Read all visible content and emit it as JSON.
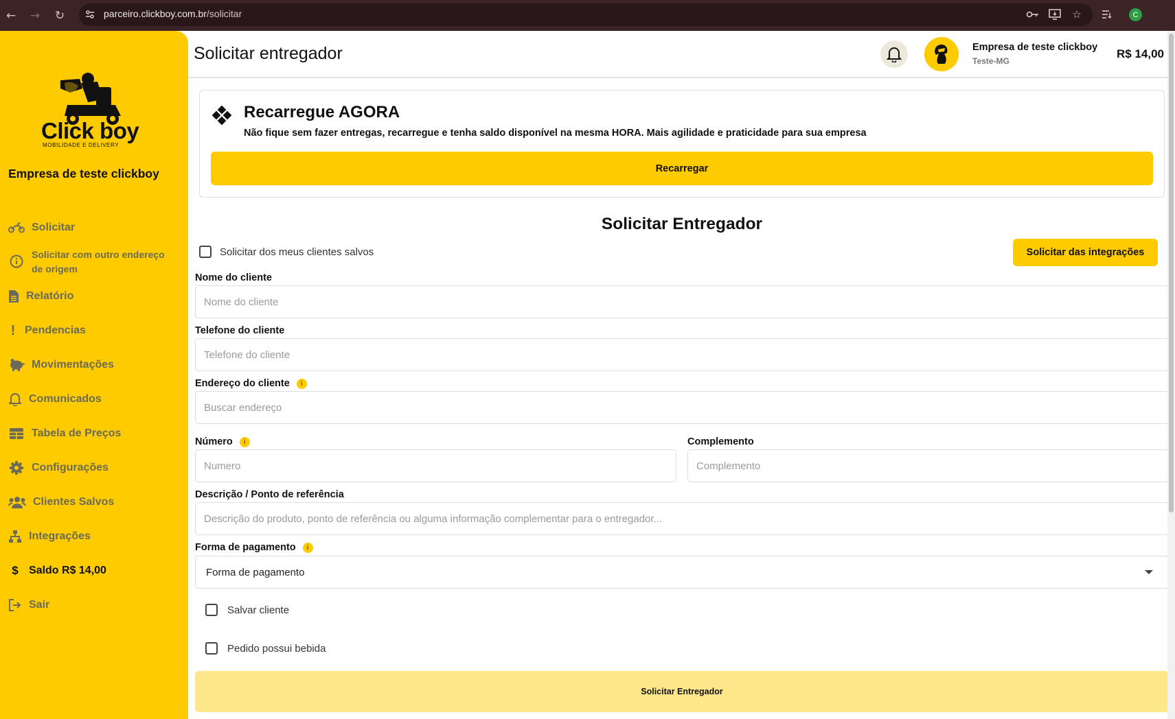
{
  "browser": {
    "url_host": "parceiro.clickboy.com.br",
    "url_path": "/solicitar"
  },
  "sidebar": {
    "logo_text": "Click boy",
    "logo_subtext": "MOBILIDADE E DELIVERY",
    "company_name": "Empresa de teste clickboy",
    "items": [
      {
        "label": "Solicitar",
        "icon": "motorcycle-icon"
      },
      {
        "label": "Solicitar com outro endereço de origem",
        "icon": "info-circle-icon"
      },
      {
        "label": "Relatório",
        "icon": "document-icon"
      },
      {
        "label": "Pendencias",
        "icon": "exclamation-icon"
      },
      {
        "label": "Movimentações",
        "icon": "piggy-bank-icon"
      },
      {
        "label": "Comunicados",
        "icon": "bell-icon"
      },
      {
        "label": "Tabela de Preços",
        "icon": "table-icon"
      },
      {
        "label": "Configurações",
        "icon": "gear-icon"
      },
      {
        "label": "Clientes Salvos",
        "icon": "users-icon"
      },
      {
        "label": "Integrações",
        "icon": "sitemap-icon"
      },
      {
        "label": "Saldo R$ 14,00",
        "icon": "dollar-icon"
      },
      {
        "label": "Sair",
        "icon": "logout-icon"
      }
    ]
  },
  "header": {
    "title": "Solicitar entregador",
    "user_name": "Empresa de teste clickboy",
    "user_location": "Teste-MG",
    "balance": "R$ 14,00"
  },
  "recharge_card": {
    "title": "Recarregue AGORA",
    "description": "Não fique sem fazer entregas, recarregue e tenha saldo disponível na mesma HORA. Mais agilidade e praticidade para sua empresa",
    "button_label": "Recarregar"
  },
  "form": {
    "title": "Solicitar Entregador",
    "saved_clients_checkbox": "Solicitar dos meus clientes salvos",
    "integrations_button": "Solicitar das integrações",
    "client_name_label": "Nome do cliente",
    "client_name_placeholder": "Nome do cliente",
    "client_phone_label": "Telefone do cliente",
    "client_phone_placeholder": "Telefone do cliente",
    "client_address_label": "Endereço do cliente",
    "client_address_placeholder": "Buscar endereço",
    "number_label": "Número",
    "number_placeholder": "Numero",
    "complement_label": "Complemento",
    "complement_placeholder": "Complemento",
    "description_label": "Descrição / Ponto de referência",
    "description_placeholder": "Descrição do produto, ponto de referência ou alguma informação complementar para o entregador...",
    "payment_label": "Forma de pagamento",
    "payment_selected": "Forma de pagamento",
    "save_client_checkbox": "Salvar cliente",
    "has_drink_checkbox": "Pedido possui bebida",
    "submit_label": "Solicitar Entregador"
  },
  "colors": {
    "brand_yellow": "#fecb00",
    "browser_bar": "#3b2326",
    "submit_disabled": "#fee78a"
  }
}
